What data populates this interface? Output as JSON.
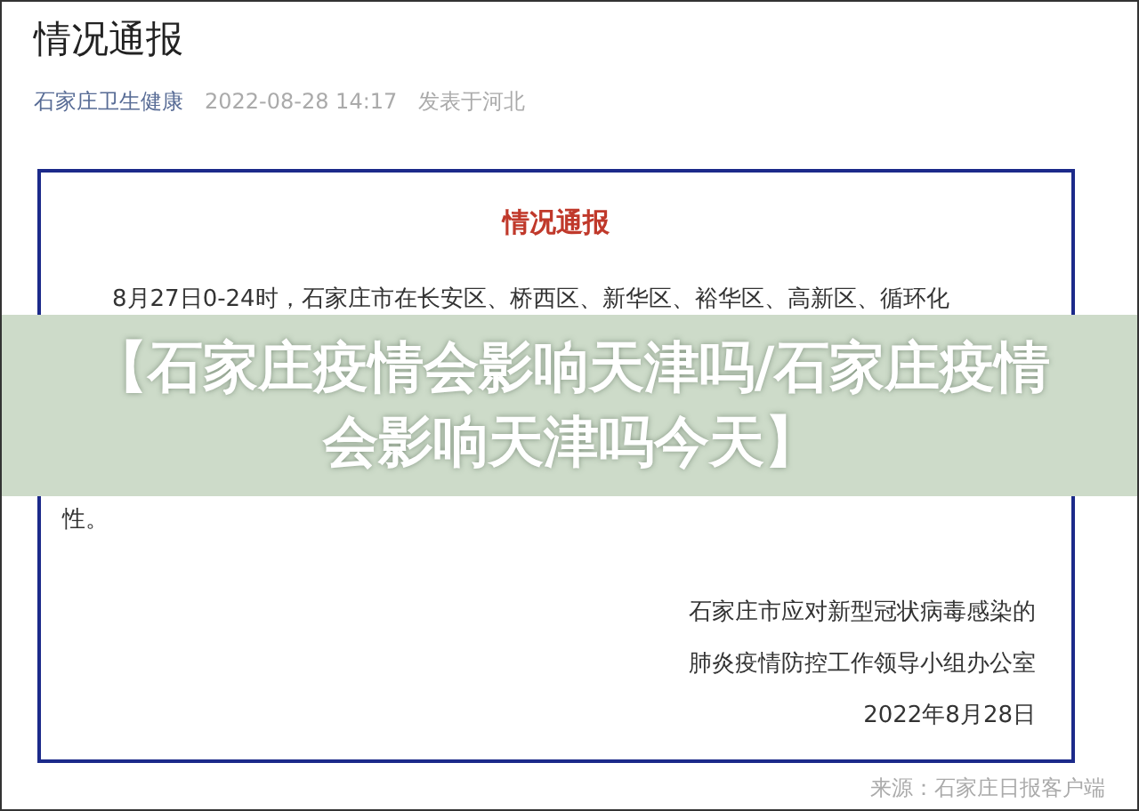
{
  "article": {
    "title": "情况通报",
    "author": "石家庄卫生健康",
    "time": "2022-08-28 14:17",
    "location": "发表于河北"
  },
  "notice": {
    "title": "情况通报",
    "lines": [
      "8月27日0-24时，石家庄市在长安区、桥西区、新华区、裕华区、高新区、循环化",
      "性。"
    ],
    "signature": [
      "石家庄市应对新型冠状病毒感染的",
      "肺炎疫情防控工作领导小组办公室",
      "2022年8月28日"
    ]
  },
  "source": "来源：石家庄日报客户端",
  "banner": "【石家庄疫情会影响天津吗/石家庄疫情会影响天津吗今天】"
}
